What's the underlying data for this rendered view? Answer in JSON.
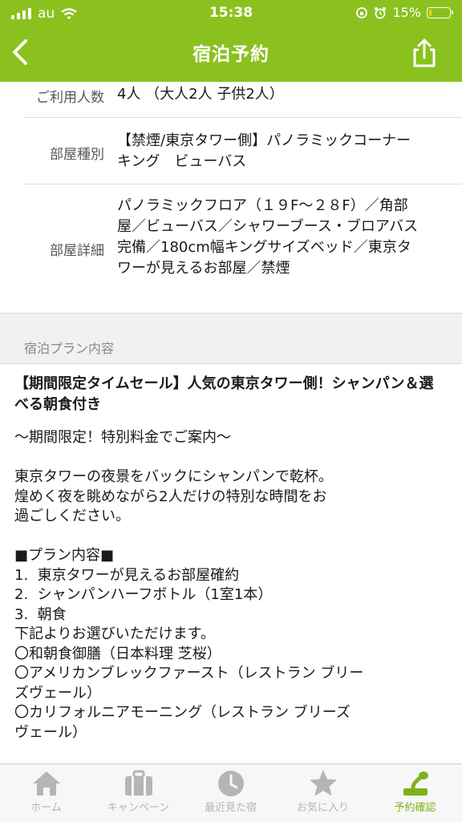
{
  "status": {
    "carrier": "au",
    "time": "15:38",
    "battery": "15%",
    "battery_level": 0.15
  },
  "nav": {
    "title": "宿泊予約",
    "back_icon": "chevron-left-icon",
    "share_icon": "share-icon"
  },
  "details": {
    "guests_label": "ご利用人数",
    "guests_value": "4人 （大人2人 子供2人）",
    "room_type_label": "部屋種別",
    "room_type_value": "【禁煙/東京タワー側】パノラミックコーナーキング　ビューバス",
    "room_detail_label": "部屋詳細",
    "room_detail_value": "パノラミックフロア（１９F〜２８F）／角部屋／ビューバス／シャワーブース・ブロアバス完備／180cm幅キングサイズベッド／東京タワーが見えるお部屋／禁煙"
  },
  "plan_section": {
    "header": "宿泊プラン内容",
    "title": "【期間限定タイムセール】人気の東京タワー側！シャンパン＆選べる朝食付き",
    "body": "〜期間限定！特別料金でご案内〜\n\n東京タワーの夜景をバックにシャンパンで乾杯。\n煌めく夜を眺めながら2人だけの特別な時間をお\n過ごしください。\n\n■プラン内容■\n1.  東京タワーが見えるお部屋確約\n2.  シャンパンハーフボトル（1室1本）\n3.  朝食\n下記よりお選びいただけます。\n〇和朝食御膳（日本料理 芝桜）\n〇アメリカンブレックファースト（レストラン ブリー\nズヴェール）\n〇カリフォルニアモーニング（レストラン ブリーズ\nヴェール）"
  },
  "tabs": [
    {
      "label": "ホーム",
      "icon": "home-icon",
      "active": false
    },
    {
      "label": "キャンペーン",
      "icon": "briefcase-icon",
      "active": false
    },
    {
      "label": "最近見た宿",
      "icon": "clock-icon",
      "active": false
    },
    {
      "label": "お気に入り",
      "icon": "star-icon",
      "active": false
    },
    {
      "label": "予約確認",
      "icon": "booking-icon",
      "active": true
    }
  ],
  "colors": {
    "brand_green": "#8bc11f",
    "tab_inactive": "#b5b5b5",
    "tab_active": "#7fb21a"
  }
}
